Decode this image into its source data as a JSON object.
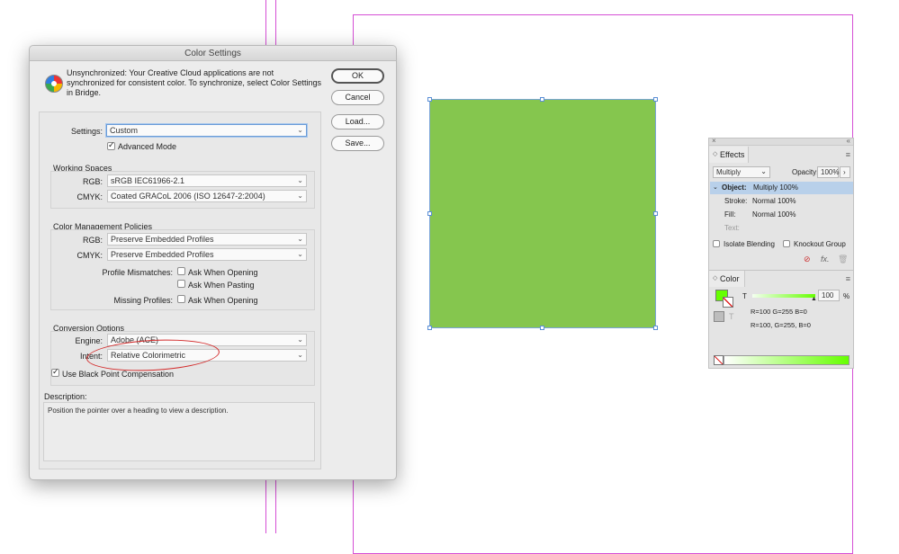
{
  "dialog": {
    "title": "Color Settings",
    "sync_message": "Unsynchronized: Your Creative Cloud applications are not synchronized for consistent color. To synchronize, select Color Settings in Bridge.",
    "buttons": {
      "ok": "OK",
      "cancel": "Cancel",
      "load": "Load...",
      "save": "Save..."
    },
    "settings_label": "Settings:",
    "settings_value": "Custom",
    "advanced_mode": "Advanced Mode",
    "working_spaces": {
      "header": "Working Spaces",
      "rgb_label": "RGB:",
      "rgb_value": "sRGB IEC61966-2.1",
      "cmyk_label": "CMYK:",
      "cmyk_value": "Coated GRACoL 2006 (ISO 12647-2:2004)"
    },
    "policies": {
      "header": "Color Management Policies",
      "rgb_label": "RGB:",
      "rgb_value": "Preserve Embedded Profiles",
      "cmyk_label": "CMYK:",
      "cmyk_value": "Preserve Embedded Profiles",
      "mismatch_label": "Profile Mismatches:",
      "ask_opening": "Ask When Opening",
      "ask_pasting": "Ask When Pasting",
      "missing_label": "Missing Profiles:",
      "missing_ask_opening": "Ask When Opening"
    },
    "conversion": {
      "header": "Conversion Options",
      "engine_label": "Engine:",
      "engine_value": "Adobe (ACE)",
      "intent_label": "Intent:",
      "intent_value": "Relative Colorimetric",
      "black_point": "Use Black Point Compensation"
    },
    "description": {
      "label": "Description:",
      "text": "Position the pointer over a heading to view a description."
    }
  },
  "effects": {
    "tab": "Effects",
    "blend_mode": "Multiply",
    "opacity_label": "Opacity:",
    "opacity_value": "100%",
    "object_row": "Object:",
    "object_value": "Multiply 100%",
    "stroke_label": "Stroke:",
    "stroke_value": "Normal 100%",
    "fill_label": "Fill:",
    "fill_value": "Normal 100%",
    "text_label": "Text:",
    "isolate": "Isolate Blending",
    "knockout": "Knockout Group"
  },
  "color": {
    "tab": "Color",
    "t_label": "T",
    "tint_value": "100",
    "pct": "%",
    "rgb_line1": "R=100 G=255 B=0",
    "rgb_line2": "R=100, G=255, B=0",
    "swatch": "#66ff00"
  }
}
